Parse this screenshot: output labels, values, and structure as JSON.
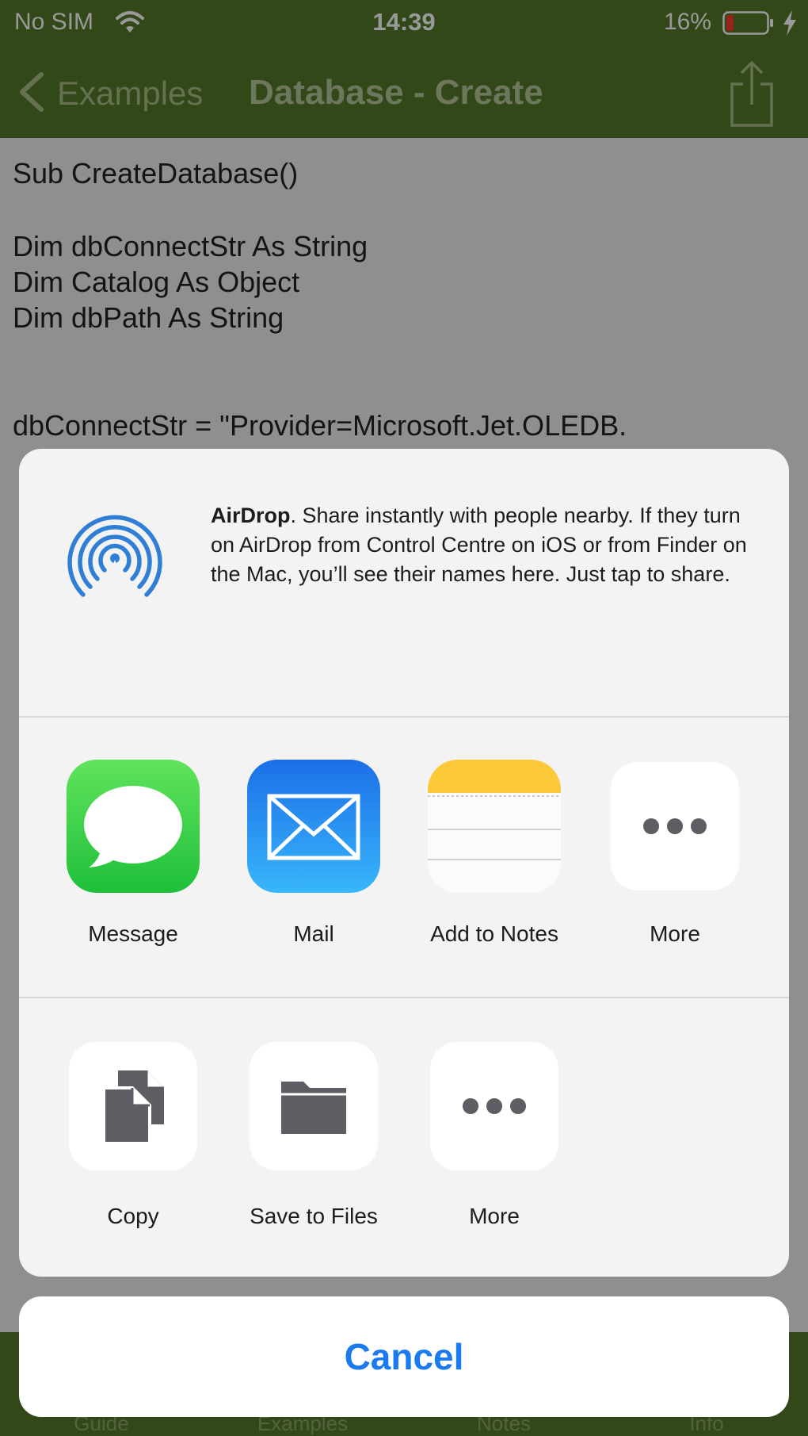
{
  "status_bar": {
    "carrier": "No SIM",
    "time": "14:39",
    "battery_percent": "16%"
  },
  "nav_bar": {
    "back_label": "Examples",
    "title": "Database - Create"
  },
  "code_lines": [
    "Sub CreateDatabase()",
    "Dim dbConnectStr As String",
    "Dim Catalog As Object",
    "Dim dbPath As String",
    "dbConnectStr = \"Provider=Microsoft.Jet.OLEDB."
  ],
  "tab_bar": {
    "tabs": [
      "Guide",
      "Examples",
      "Notes",
      "Info"
    ]
  },
  "share_sheet": {
    "airdrop": {
      "title": "AirDrop",
      "description": ". Share instantly with people nearby. If they turn on AirDrop from Control Centre on iOS or from Finder on the Mac, you’ll see their names here. Just tap to share."
    },
    "apps": [
      {
        "label": "Message",
        "icon": "messages-icon"
      },
      {
        "label": "Mail",
        "icon": "mail-icon"
      },
      {
        "label": "Add to Notes",
        "icon": "notes-icon"
      },
      {
        "label": "More",
        "icon": "more-icon"
      }
    ],
    "actions": [
      {
        "label": "Copy",
        "icon": "copy-icon"
      },
      {
        "label": "Save to Files",
        "icon": "folder-icon"
      },
      {
        "label": "More",
        "icon": "more-icon"
      }
    ],
    "cancel_label": "Cancel"
  },
  "colors": {
    "nav_green": "#56782a",
    "ios_blue": "#1a7af0"
  }
}
